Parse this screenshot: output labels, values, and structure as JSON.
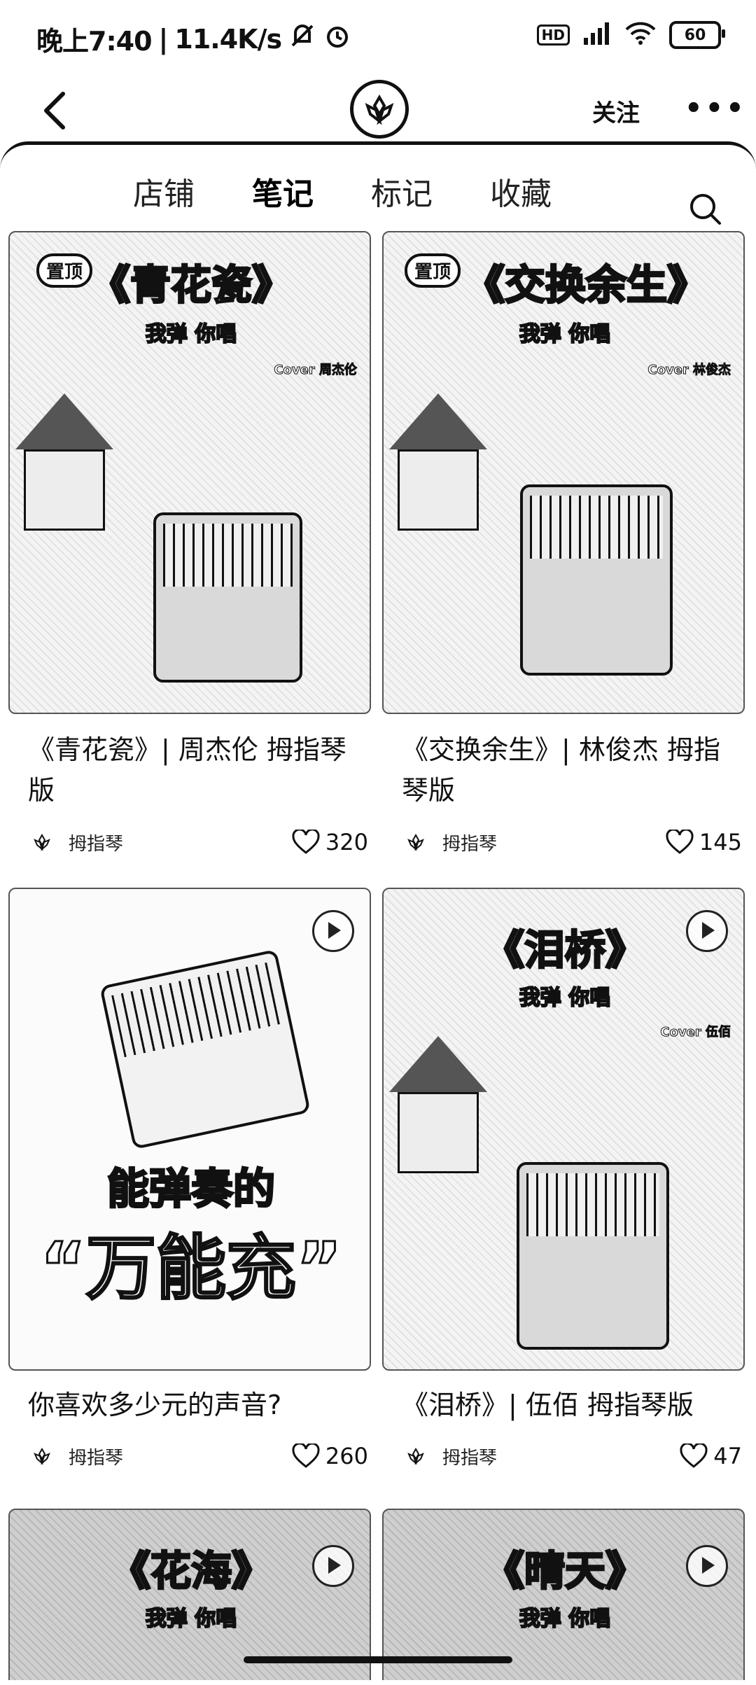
{
  "status_bar": {
    "time": "晚上7:40",
    "network_speed": "11.4K/s",
    "signal_label": "HD",
    "battery": "60",
    "icons": [
      "mute-icon",
      "alarm-icon",
      "signal-icon",
      "wifi-icon",
      "battery-icon"
    ]
  },
  "app_bar": {
    "back_icon": "chevron-left-icon",
    "logo_icon": "kalimba-brand-logo",
    "follow_label": "关注",
    "more_label": "•••"
  },
  "tabs": [
    {
      "label": "店铺",
      "active": false
    },
    {
      "label": "笔记",
      "active": true
    },
    {
      "label": "标记",
      "active": false
    },
    {
      "label": "收藏",
      "active": false
    }
  ],
  "search_icon": "search-icon",
  "cards": [
    {
      "pinned_label": "置顶",
      "art_title": "《青花瓷》",
      "art_subtitle": "我弹 你唱",
      "art_cover": "Cover 周杰伦",
      "caption": "《青花瓷》| 周杰伦 拇指琴版",
      "brand": "拇指琴",
      "likes": "320",
      "has_video": false
    },
    {
      "pinned_label": "置顶",
      "art_title": "《交换余生》",
      "art_subtitle": "我弹 你唱",
      "art_cover": "Cover 林俊杰",
      "caption": "《交换余生》| 林俊杰 拇指琴版",
      "brand": "拇指琴",
      "likes": "145",
      "has_video": false
    },
    {
      "art_line1": "能弹奏的",
      "art_line2": "“万能充”",
      "caption": "你喜欢多少元的声音?",
      "brand": "拇指琴",
      "likes": "260",
      "has_video": true
    },
    {
      "art_title": "《泪桥》",
      "art_subtitle": "我弹 你唱",
      "art_cover": "Cover 伍佰",
      "caption": "《泪桥》| 伍佰 拇指琴版",
      "brand": "拇指琴",
      "likes": "47",
      "has_video": true
    },
    {
      "art_title": "《花海》",
      "art_subtitle": "我弹 你唱",
      "has_video": true
    },
    {
      "art_title": "《晴天》",
      "art_subtitle": "我弹 你唱",
      "has_video": true
    }
  ]
}
